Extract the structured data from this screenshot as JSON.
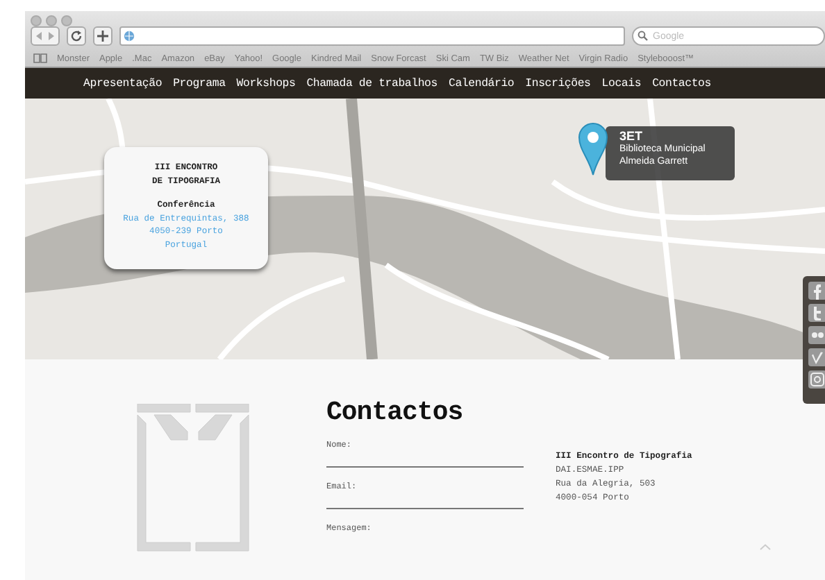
{
  "browser": {
    "search": {
      "placeholder": "Google"
    },
    "bookmarks": [
      "Monster",
      "Apple",
      ".Mac",
      "Amazon",
      "eBay",
      "Yahoo!",
      "Google",
      "Kindred Mail",
      "Snow Forcast",
      "Ski Cam",
      "TW Biz",
      "Weather Net",
      "Virgin Radio",
      "Stylebooost™"
    ]
  },
  "nav": {
    "items": [
      "Apresentação",
      "Programa",
      "Workshops",
      "Chamada de trabalhos",
      "Calendário",
      "Inscrições",
      "Locais",
      "Contactos"
    ]
  },
  "map": {
    "info_card": {
      "title_lines": [
        "III ENCONTRO",
        "DE TIPOGRAFIA"
      ],
      "subtitle": "Conferência",
      "address_lines": [
        "Rua de Entrequintas, 388",
        "4050-239 Porto",
        "Portugal"
      ]
    },
    "marker": {
      "title": "3ET",
      "lines": [
        "Biblioteca Municipal",
        "Almeida Garrett"
      ]
    }
  },
  "social_links": [
    {
      "kind": "facebook"
    },
    {
      "kind": "twitter"
    },
    {
      "kind": "flickr"
    },
    {
      "kind": "vimeo"
    },
    {
      "kind": "instagram"
    }
  ],
  "contact": {
    "heading": "Contactos",
    "fields": [
      {
        "label": "Nome:",
        "kind": "line"
      },
      {
        "label": "Email:",
        "kind": "line"
      },
      {
        "label": "Mensagem:",
        "kind": "area"
      }
    ],
    "address": {
      "title": "III Encontro de Tipografia",
      "lines": [
        "DAI.ESMAE.IPP",
        "Rua da Alegria, 503",
        "4000-054 Porto"
      ]
    }
  }
}
